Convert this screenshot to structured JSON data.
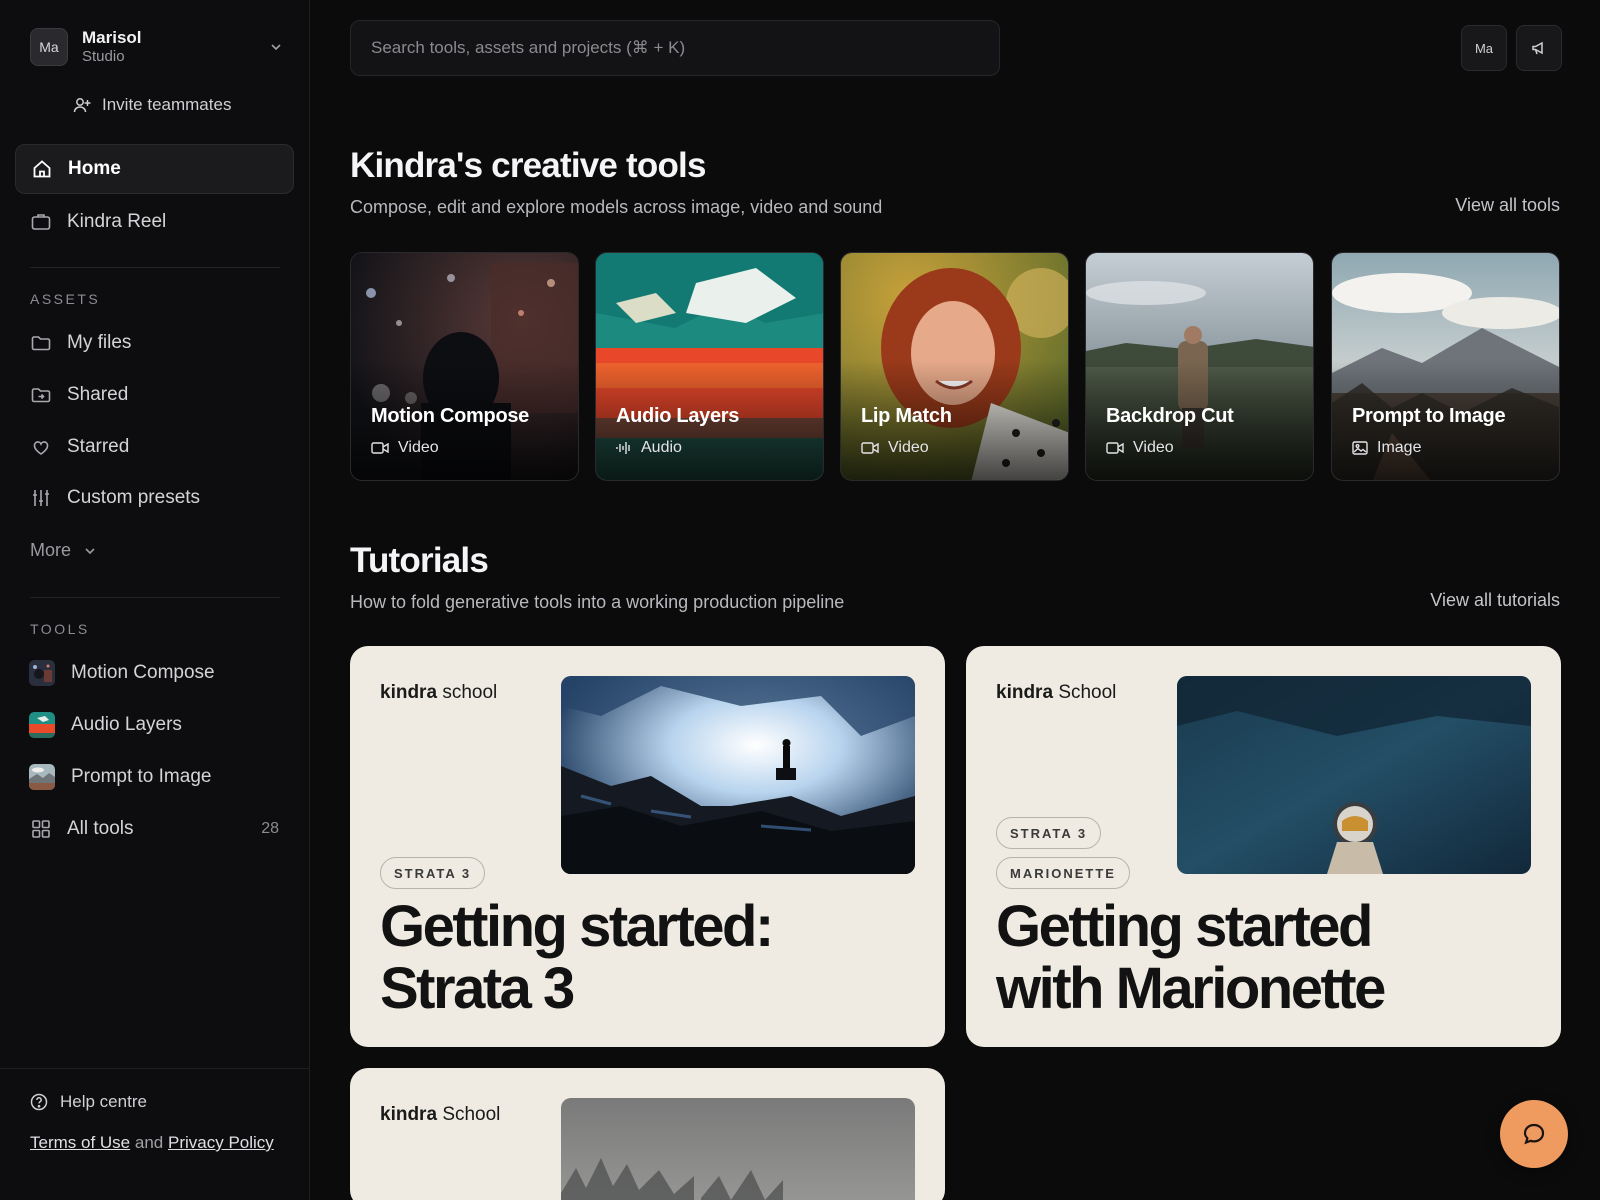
{
  "workspace": {
    "avatar": "Ma",
    "name": "Marisol",
    "plan": "Studio"
  },
  "sidebar": {
    "invite_label": "Invite teammates",
    "home": "Home",
    "reel": "Kindra Reel",
    "assets_heading": "ASSETS",
    "assets": [
      "My files",
      "Shared",
      "Starred",
      "Custom presets"
    ],
    "more": "More",
    "tools_heading": "TOOLS",
    "tools": [
      "Motion Compose",
      "Audio Layers",
      "Prompt to Image"
    ],
    "all_tools": "All tools",
    "all_tools_count": "28",
    "help": "Help centre",
    "terms": "Terms of Use",
    "and": "and",
    "privacy": "Privacy Policy"
  },
  "header": {
    "search_placeholder": "Search tools, assets and projects (⌘ + K)",
    "avatar": "Ma"
  },
  "creative": {
    "title": "Kindra's creative tools",
    "subtitle": "Compose, edit and explore models across image, video and sound",
    "view_all": "View all tools",
    "cards": [
      {
        "name": "Motion Compose",
        "kind": "Video",
        "icon": "video-icon"
      },
      {
        "name": "Audio Layers",
        "kind": "Audio",
        "icon": "audio-wave-icon"
      },
      {
        "name": "Lip Match",
        "kind": "Video",
        "icon": "video-icon"
      },
      {
        "name": "Backdrop Cut",
        "kind": "Video",
        "icon": "video-icon"
      },
      {
        "name": "Prompt to Image",
        "kind": "Image",
        "icon": "image-icon"
      }
    ]
  },
  "tutorials": {
    "title": "Tutorials",
    "subtitle": "How to fold generative tools into a working production pipeline",
    "view_all": "View all tutorials",
    "cards": [
      {
        "brand_bold": "kindra",
        "brand_rest": "school",
        "tags": [
          "STRATA 3"
        ],
        "title_line1": "Getting started:",
        "title_line2": "Strata 3"
      },
      {
        "brand_bold": "kindra",
        "brand_rest": "School",
        "tags": [
          "STRATA 3",
          "MARIONETTE"
        ],
        "title_line1": "Getting started",
        "title_line2": "with Marionette"
      },
      {
        "brand_bold": "kindra",
        "brand_rest": "School",
        "tags": [],
        "title_line1": "",
        "title_line2": ""
      }
    ]
  },
  "colors": {
    "background": "#0b0b0c",
    "card": "#efebe2",
    "accent": "#ef9a5e"
  }
}
